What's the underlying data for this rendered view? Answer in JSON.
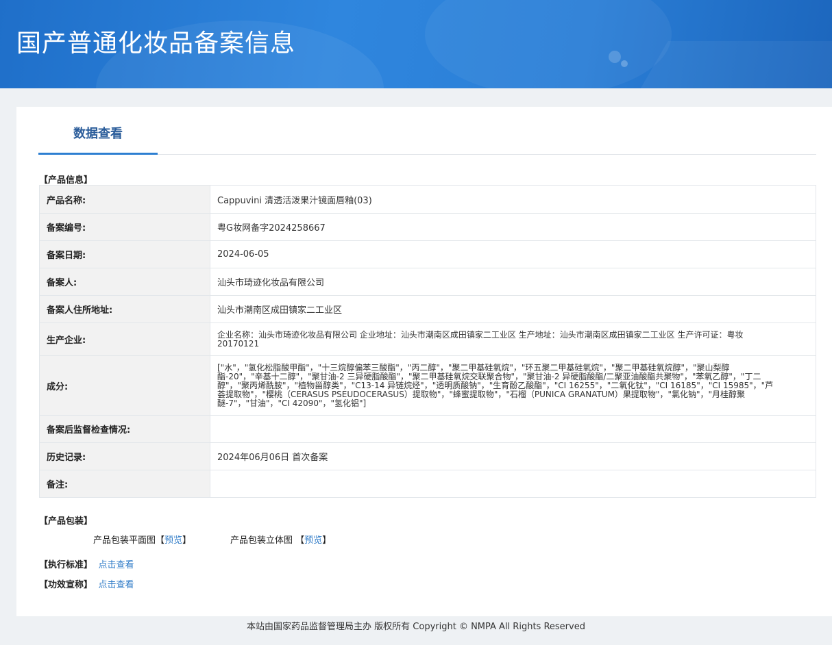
{
  "header": {
    "title": "国产普通化妆品备案信息"
  },
  "tab": {
    "label": "数据查看"
  },
  "product_info": {
    "section_title": "【产品信息】",
    "rows": [
      {
        "label": "产品名称:",
        "value": "Cappuvini 清透活泼果汁镜面唇釉(03)"
      },
      {
        "label": "备案编号:",
        "value": "粤G妆网备字2024258667"
      },
      {
        "label": "备案日期:",
        "value": "2024-06-05"
      },
      {
        "label": "备案人:",
        "value": "汕头市琦迹化妆品有限公司"
      },
      {
        "label": "备案人住所地址:",
        "value": "汕头市潮南区成田镇家二工业区"
      },
      {
        "label": "生产企业:",
        "value": "企业名称：汕头市琦迹化妆品有限公司 企业地址：汕头市潮南区成田镇家二工业区 生产地址：汕头市潮南区成田镇家二工业区 生产许可证：粤妆20170121"
      },
      {
        "label": "成分:",
        "value": "[\"水\"，\"氢化松脂酸甲酯\"，\"十三烷醇偏苯三酸酯\"，\"丙二醇\"，\"聚二甲基硅氧烷\"，\"环五聚二甲基硅氧烷\"，\"聚二甲基硅氧烷醇\"，\"聚山梨醇酯-20\"，\"辛基十二醇\"，\"聚甘油-2 三异硬脂酸酯\"，\"聚二甲基硅氧烷交联聚合物\"，\"聚甘油-2 异硬脂酸酯/二聚亚油酸酯共聚物\"，\"苯氧乙醇\"，\"丁二醇\"，\"聚丙烯酰胺\"，\"植物甾醇类\"，\"C13-14 异链烷烃\"，\"透明质酸钠\"，\"生育酚乙酸酯\"，\"CI 16255\"，\"二氧化钛\"，\"CI 16185\"，\"CI 15985\"，\"芦荟提取物\"，\"樱桃（CERASUS PSEUDOCERASUS）提取物\"，\"蜂蜜提取物\"，\"石榴（PUNICA GRANATUM）果提取物\"，\"氯化钠\"，\"月桂醇聚醚-7\"，\"甘油\"，\"CI 42090\"，\"氢化铝\"]"
      },
      {
        "label": "备案后监督检查情况:",
        "value": ""
      },
      {
        "label": "历史记录:",
        "value": "2024年06月06日 首次备案"
      },
      {
        "label": "备注:",
        "value": ""
      }
    ]
  },
  "packaging": {
    "section_title": "【产品包装】",
    "flat_label": "产品包装平面图",
    "solid_label": "产品包装立体图",
    "preview_label": "预览",
    "bracket_open": "【",
    "bracket_close": "】"
  },
  "standard": {
    "section_title": "【执行标准】",
    "link": "点击查看"
  },
  "efficacy": {
    "section_title": "【功效宣称】",
    "link": "点击查看"
  },
  "footer": {
    "text": "本站由国家药品监督管理局主办 版权所有 Copyright © NMPA All Rights Reserved"
  }
}
